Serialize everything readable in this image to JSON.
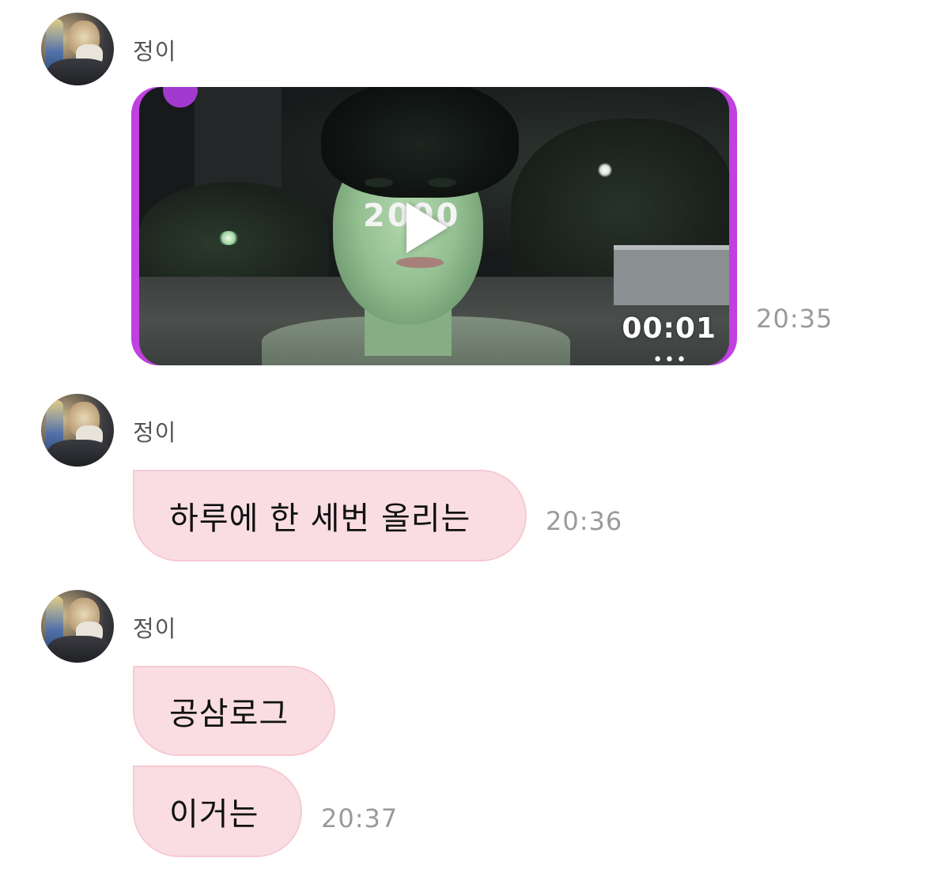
{
  "messages": [
    {
      "sender": "정이",
      "type": "video",
      "video": {
        "overlay_text": "2000",
        "duration": "00:01",
        "more": "•••"
      },
      "time": "20:35"
    },
    {
      "sender": "정이",
      "type": "text",
      "bubbles": [
        "하루에 한 세번 올리는"
      ],
      "time": "20:36"
    },
    {
      "sender": "정이",
      "type": "text",
      "bubbles": [
        "공삼로그",
        "이거는"
      ],
      "time": "20:37"
    }
  ],
  "colors": {
    "bubble_bg": "#f9dde3",
    "bubble_border": "#f6cad3",
    "video_frame": "#c040e0",
    "time_text": "#9a9a9a",
    "sender_text": "#555555"
  }
}
